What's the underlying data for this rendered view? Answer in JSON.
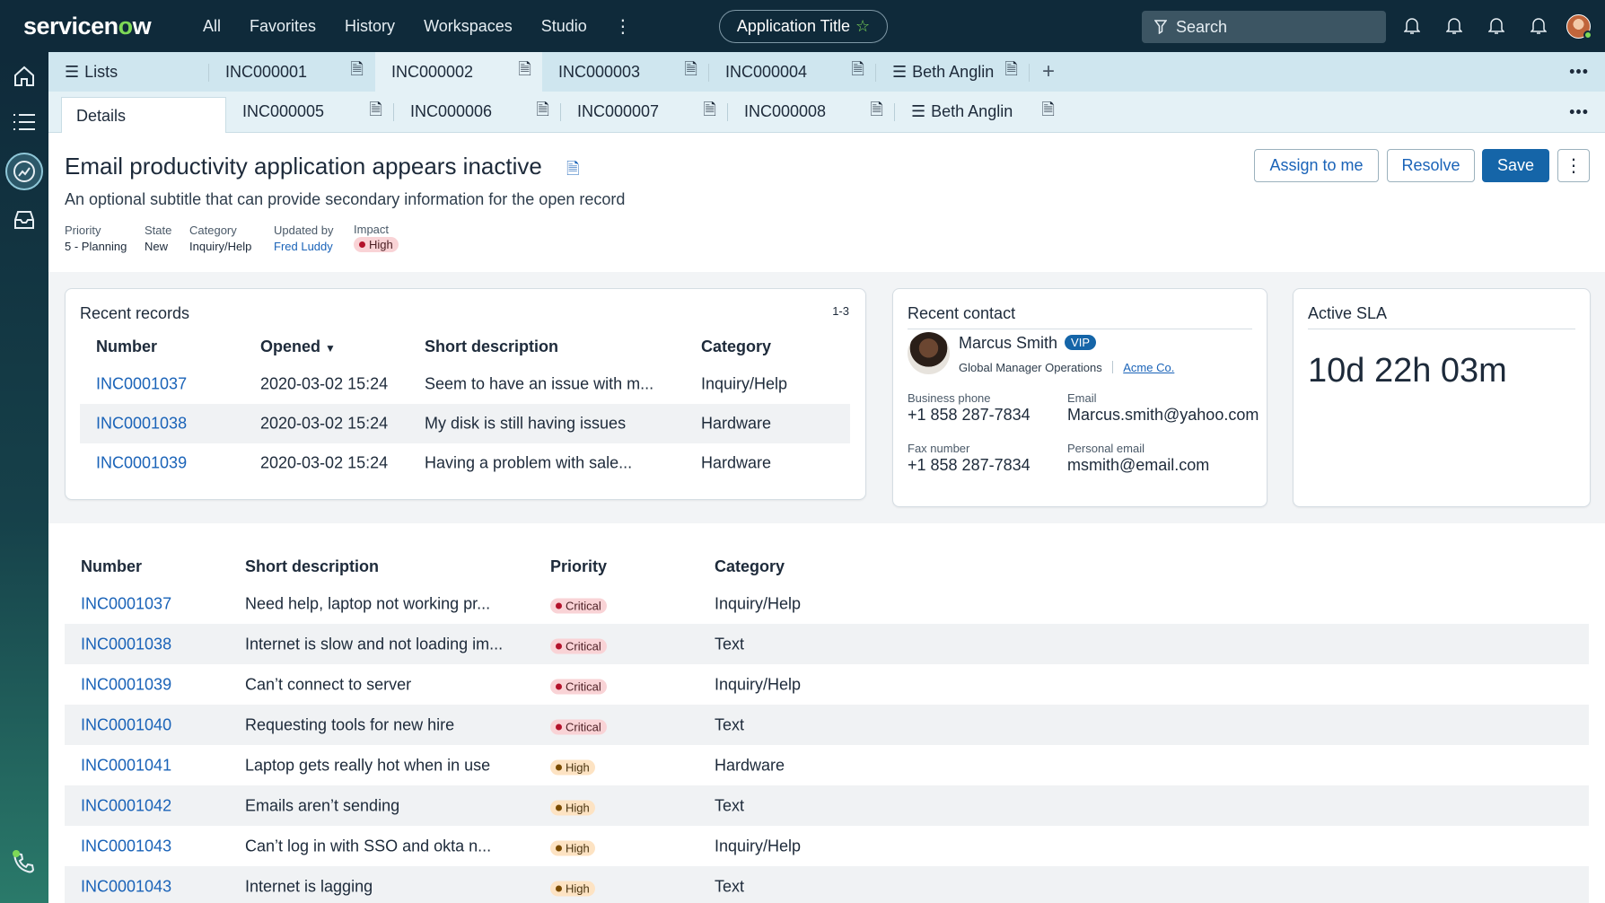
{
  "header": {
    "logo": "servicenow",
    "nav": [
      "All",
      "Favorites",
      "History",
      "Workspaces",
      "Studio"
    ],
    "app_title": "Application Title",
    "search_placeholder": "Search"
  },
  "tabs_row1": [
    {
      "label": "Lists",
      "icon": "list-icon"
    },
    {
      "label": "INC000001",
      "icon": "doc-icon"
    },
    {
      "label": "INC000002",
      "icon": "doc-icon",
      "active": true
    },
    {
      "label": "INC000003",
      "icon": "doc-icon"
    },
    {
      "label": "INC000004",
      "icon": "doc-icon"
    },
    {
      "label": "Beth Anglin",
      "icon": "list-icon"
    }
  ],
  "tabs_row2": [
    {
      "label": "Details",
      "active": true
    },
    {
      "label": "INC000005"
    },
    {
      "label": "INC000006"
    },
    {
      "label": "INC000007"
    },
    {
      "label": "INC000008"
    },
    {
      "label": "Beth Anglin"
    }
  ],
  "record": {
    "title": "Email productivity application appears inactive",
    "subtitle": "An optional subtitle that can provide secondary information for the open record",
    "meta": [
      {
        "label": "Priority",
        "value": "5 - Planning"
      },
      {
        "label": "State",
        "value": "New"
      },
      {
        "label": "Category",
        "value": "Inquiry/Help"
      },
      {
        "label": "Updated by",
        "value": "Fred Luddy"
      },
      {
        "label": "Impact",
        "value": "High"
      }
    ],
    "actions": {
      "assign": "Assign to me",
      "resolve": "Resolve",
      "save": "Save"
    }
  },
  "recent_records": {
    "title": "Recent records",
    "range": "1-3",
    "columns": [
      "Number",
      "Opened",
      "Short description",
      "Category"
    ],
    "rows": [
      [
        "INC0001037",
        "2020-03-02 15:24",
        "Seem to have an issue with m...",
        "Inquiry/Help"
      ],
      [
        "INC0001038",
        "2020-03-02 15:24",
        "My disk is still having issues",
        "Hardware"
      ],
      [
        "INC0001039",
        "2020-03-02 15:24",
        "Having a problem with sale...",
        "Hardware"
      ]
    ]
  },
  "recent_contact": {
    "title": "Recent contact",
    "name": "Marcus Smith",
    "vip": "VIP",
    "role": "Global Manager Operations",
    "company": "Acme Co.",
    "business_phone_label": "Business phone",
    "business_phone": "+1 858 287-7834",
    "email_label": "Email",
    "email": "Marcus.smith@yahoo.com",
    "fax_label": "Fax number",
    "fax": "+1 858 287-7834",
    "personal_email_label": "Personal email",
    "personal_email": "msmith@email.com"
  },
  "active_sla": {
    "title": "Active SLA",
    "value": "10d 22h 03m"
  },
  "main_table": {
    "columns": [
      "Number",
      "Short description",
      "Priority",
      "Category"
    ],
    "rows": [
      [
        "INC0001037",
        "Need help, laptop not working pr...",
        "Critical",
        "Inquiry/Help"
      ],
      [
        "INC0001038",
        "Internet is slow and not loading im...",
        "Critical",
        "Text"
      ],
      [
        "INC0001039",
        "Can’t connect to server",
        "Critical",
        "Inquiry/Help"
      ],
      [
        "INC0001040",
        "Requesting tools for new hire",
        "Critical",
        "Text"
      ],
      [
        "INC0001041",
        "Laptop gets really hot when in use",
        "High",
        "Hardware"
      ],
      [
        "INC0001042",
        "Emails aren’t sending",
        "High",
        "Text"
      ],
      [
        "INC0001043",
        "Can’t log in with SSO and okta n...",
        "High",
        "Inquiry/Help"
      ],
      [
        "INC0001043",
        "Internet is lagging",
        "High",
        "Text"
      ]
    ]
  },
  "colors": {
    "header_bg": "#0f2a3a",
    "accent_green": "#7ed957",
    "link": "#1a63b8",
    "primary_button": "#1565a8",
    "critical_badge": "#f9d3d6",
    "high_badge": "#fde3c3"
  }
}
